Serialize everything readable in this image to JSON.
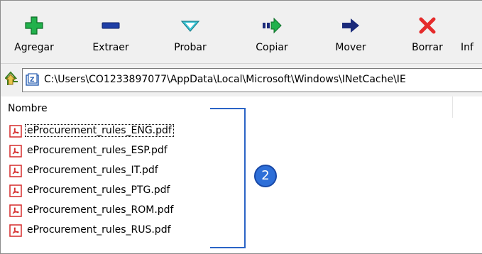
{
  "toolbar": {
    "buttons": [
      {
        "label": "Agregar",
        "icon": "plus-icon"
      },
      {
        "label": "Extraer",
        "icon": "minus-icon"
      },
      {
        "label": "Probar",
        "icon": "check-icon"
      },
      {
        "label": "Copiar",
        "icon": "copy-arrow-icon"
      },
      {
        "label": "Mover",
        "icon": "move-arrow-icon"
      },
      {
        "label": "Borrar",
        "icon": "delete-x-icon"
      },
      {
        "label": "Inf",
        "icon": "info-icon"
      }
    ]
  },
  "address": {
    "path": "C:\\Users\\CO1233897077\\AppData\\Local\\Microsoft\\Windows\\INetCache\\IE"
  },
  "file_list": {
    "column_header": "Nombre",
    "files": [
      "eProcurement_rules_ENG.pdf",
      "eProcurement_rules_ESP.pdf",
      "eProcurement_rules_IT.pdf",
      "eProcurement_rules_PTG.pdf",
      "eProcurement_rules_ROM.pdf",
      "eProcurement_rules_RUS.pdf"
    ]
  },
  "annotation": {
    "callout_number": "2",
    "color": "#2e6fd8"
  },
  "colors": {
    "plus": "#22b14c",
    "minus": "#1f3fa6",
    "check": "#3dc6d6",
    "move": "#1a2a7a",
    "delete": "#e52b2b"
  }
}
